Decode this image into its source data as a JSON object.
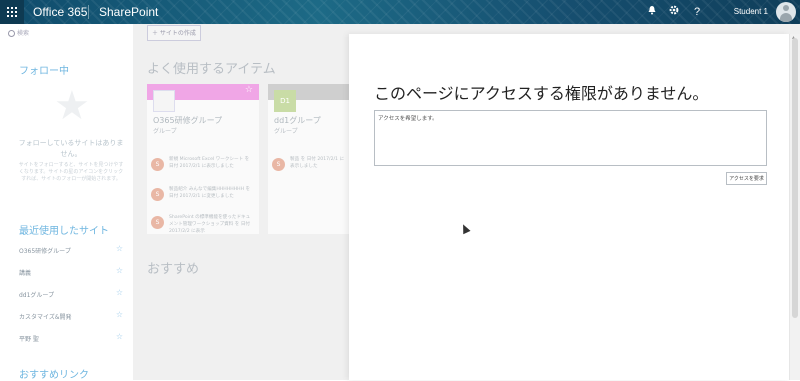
{
  "topbar": {
    "app_name": "Office 365",
    "product": "SharePoint",
    "user": "Student 1",
    "bell_icon": "bell-icon",
    "gear_icon": "gear-icon",
    "help_label": "?"
  },
  "leftnav": {
    "search_placeholder": "検索",
    "following_heading": "フォロー中",
    "following_empty_title": "フォローしているサイトはありません。",
    "following_empty_desc": "サイトをフォローすると、サイトを見つけやすくなります。サイトの星のアイコンをクリックすれば、サイトのフォローが開始されます。",
    "recent_heading": "最近使用したサイト",
    "recent_items": [
      {
        "label": "O365研修グループ"
      },
      {
        "label": "講義"
      },
      {
        "label": "dd1グループ"
      },
      {
        "label": "カスタマイズ&開発"
      },
      {
        "label": "平野 聖"
      }
    ],
    "suggested_links_heading": "おすすめリンク"
  },
  "main": {
    "create_site": "＋ サイトの作成",
    "frequent_heading": "よく使用するアイテム",
    "recommended_heading": "おすすめ",
    "cards": [
      {
        "title": "O365研修グループ",
        "subtitle": "グループ",
        "band_color": "#f0a6e6",
        "activities": [
          {
            "avatar": "S",
            "text": "新規 Microsoft Excel ワークシート を 日付 2017/2/1 に表示しました"
          },
          {
            "avatar": "S",
            "text": "製品紹介 みんなで編集HHHHHHHH を 日付 2017/2/1 に変更しました"
          },
          {
            "avatar": "S",
            "text": "SharePoint の標準機能を使ったドキュメント管理ワークショップ資料 を 日付 2017/2/2 に表示"
          }
        ]
      },
      {
        "title": "dd1グループ",
        "subtitle": "グループ",
        "thumb": "D1",
        "band_color": "#cfcfcf",
        "activities": [
          {
            "avatar": "S",
            "text": "製品 を 日付 2017/2/1 に表示しました"
          }
        ]
      }
    ]
  },
  "panel": {
    "title": "このページにアクセスする権限がありません。",
    "message": "アクセスを希望します。",
    "request_button": "アクセスを要求"
  }
}
